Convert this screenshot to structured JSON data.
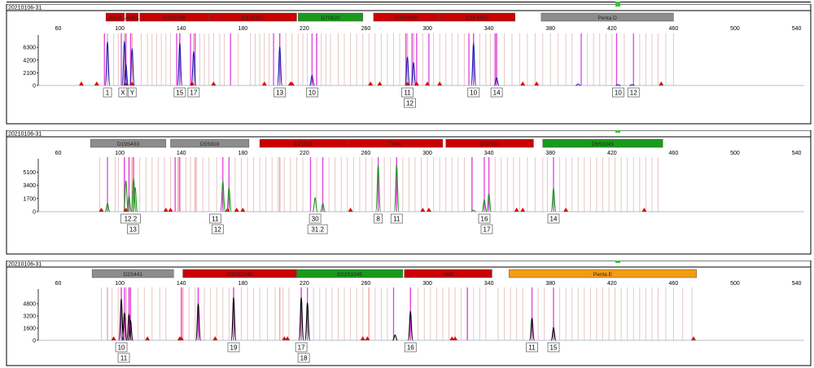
{
  "colors": {
    "red": "#cc0000",
    "green": "#1a9a1a",
    "grey": "#8c8c8c",
    "orange": "#f39c12",
    "blue": "#1c1cb4",
    "magenta": "#dd44dd",
    "indicator": "#2ecc2e"
  },
  "chart_data": [
    {
      "type": "line",
      "title": "20210106-31",
      "x_ticks": [
        60,
        100,
        140,
        180,
        220,
        260,
        300,
        340,
        380,
        420,
        460,
        500,
        540
      ],
      "y_ticks": [
        "6300",
        "4200",
        "2100",
        "0"
      ],
      "ylim": [
        0,
        7800
      ],
      "xlim": [
        47,
        545
      ],
      "series_color": "blue",
      "markers": [
        {
          "name": "Amel",
          "color": "red",
          "x1": 91,
          "x2": 103
        },
        {
          "name": "AMEL",
          "color": "red",
          "x1": 104,
          "x2": 112
        },
        {
          "name": "D3S1358",
          "color": "red",
          "x1": 113,
          "x2": 158
        },
        {
          "name": "D13S317",
          "color": "red",
          "x1": 158,
          "x2": 215
        },
        {
          "name": "D7S820",
          "color": "green",
          "x1": 216,
          "x2": 258
        },
        {
          "name": "D16S539",
          "color": "red",
          "x1": 265,
          "x2": 307
        },
        {
          "name": "CSF1PO",
          "color": "red",
          "x1": 307,
          "x2": 357
        },
        {
          "name": "Penta D",
          "color": "grey",
          "x1": 374,
          "x2": 460
        }
      ],
      "peaks": [
        {
          "x": 92,
          "y": 7200
        },
        {
          "x": 103,
          "y": 7300
        },
        {
          "x": 104,
          "y": 3500
        },
        {
          "x": 108,
          "y": 6100
        },
        {
          "x": 139,
          "y": 7000
        },
        {
          "x": 148,
          "y": 5600
        },
        {
          "x": 204,
          "y": 6400
        },
        {
          "x": 225,
          "y": 1700
        },
        {
          "x": 287,
          "y": 4700
        },
        {
          "x": 291,
          "y": 3800
        },
        {
          "x": 330,
          "y": 7000
        },
        {
          "x": 345,
          "y": 1300
        },
        {
          "x": 398,
          "y": 250
        },
        {
          "x": 424,
          "y": 150
        },
        {
          "x": 433,
          "y": 150
        }
      ],
      "alleles": [
        {
          "x": 92,
          "labels": [
            "1"
          ]
        },
        {
          "x": 102,
          "labels": [
            "X"
          ]
        },
        {
          "x": 108,
          "labels": [
            "Y"
          ]
        },
        {
          "x": 139,
          "labels": [
            "15"
          ]
        },
        {
          "x": 148,
          "labels": [
            "17"
          ]
        },
        {
          "x": 204,
          "labels": [
            "13"
          ]
        },
        {
          "x": 225,
          "labels": [
            "10"
          ]
        },
        {
          "x": 287,
          "labels": [
            "11",
            "12"
          ]
        },
        {
          "x": 330,
          "labels": [
            "10"
          ]
        },
        {
          "x": 345,
          "labels": [
            "14"
          ]
        },
        {
          "x": 424,
          "labels": [
            "10"
          ]
        },
        {
          "x": 434,
          "labels": [
            "12"
          ]
        }
      ],
      "bins": [
        90,
        101,
        104,
        107,
        137,
        139,
        146,
        149,
        172,
        200,
        204,
        225,
        228,
        286,
        290,
        293,
        301,
        327,
        330,
        344,
        345,
        400,
        423,
        434
      ],
      "bin_lines": [
        96,
        99,
        114,
        118,
        121,
        124,
        127,
        130,
        133,
        152,
        155,
        158,
        161,
        165,
        168,
        177,
        185,
        188,
        191,
        194,
        197,
        208,
        212,
        216,
        219,
        222,
        231,
        234,
        237,
        242,
        246,
        250,
        254,
        258,
        262,
        266,
        270,
        274,
        278,
        282,
        297,
        304,
        308,
        312,
        316,
        320,
        324,
        334,
        338,
        341,
        350,
        355,
        360,
        365,
        370,
        375,
        380,
        385,
        390,
        394,
        404,
        408,
        412,
        416,
        420,
        428,
        438,
        442,
        446,
        450,
        455,
        460
      ],
      "markers_pink": [
        92,
        103,
        108,
        139,
        148,
        204,
        228,
        287,
        291,
        330,
        345
      ],
      "spikes": [
        75,
        85,
        104,
        108,
        147,
        161,
        194,
        211,
        212,
        263,
        269,
        287,
        293,
        300,
        308,
        362,
        371,
        452
      ]
    },
    {
      "type": "line",
      "title": "20210106-31",
      "x_ticks": [
        60,
        100,
        140,
        180,
        220,
        260,
        300,
        340,
        380,
        420,
        460,
        500,
        540
      ],
      "y_ticks": [
        "5100",
        "3400",
        "1700",
        "0"
      ],
      "ylim": [
        0,
        6400
      ],
      "xlim": [
        47,
        545
      ],
      "series_color": "green",
      "markers": [
        {
          "name": "D19S433",
          "color": "grey",
          "x1": 81,
          "x2": 130
        },
        {
          "name": "D5S818",
          "color": "grey",
          "x1": 133,
          "x2": 184
        },
        {
          "name": "D21S11",
          "color": "red",
          "x1": 191,
          "x2": 248
        },
        {
          "name": "TH01",
          "color": "red",
          "x1": 248,
          "x2": 310
        },
        {
          "name": "D18S51",
          "color": "red",
          "x1": 312,
          "x2": 369
        },
        {
          "name": "D6S1043",
          "color": "green",
          "x1": 375,
          "x2": 453
        }
      ],
      "peaks": [
        {
          "x": 92,
          "y": 1100
        },
        {
          "x": 104,
          "y": 4000
        },
        {
          "x": 106,
          "y": 2000
        },
        {
          "x": 109,
          "y": 4300
        },
        {
          "x": 110,
          "y": 3100
        },
        {
          "x": 167,
          "y": 3900
        },
        {
          "x": 171,
          "y": 3100
        },
        {
          "x": 227,
          "y": 1800
        },
        {
          "x": 232,
          "y": 1100
        },
        {
          "x": 268,
          "y": 6000
        },
        {
          "x": 280,
          "y": 6000
        },
        {
          "x": 330,
          "y": 200
        },
        {
          "x": 337,
          "y": 1600
        },
        {
          "x": 340,
          "y": 2300
        },
        {
          "x": 382,
          "y": 3000
        }
      ],
      "alleles": [
        {
          "x": 107,
          "labels": [
            "12.2",
            "13"
          ]
        },
        {
          "x": 162,
          "labels": [
            "11",
            "12"
          ]
        },
        {
          "x": 227,
          "labels": [
            "30",
            "31.2"
          ]
        },
        {
          "x": 268,
          "labels": [
            "8"
          ]
        },
        {
          "x": 280,
          "labels": [
            "11"
          ]
        },
        {
          "x": 337,
          "labels": [
            "16",
            "17"
          ]
        },
        {
          "x": 382,
          "labels": [
            "14"
          ]
        }
      ],
      "bins": [
        92,
        103,
        106,
        109,
        136,
        139,
        167,
        171,
        224,
        232,
        268,
        280,
        329,
        337,
        340,
        382
      ],
      "bin_lines": [
        87,
        97,
        99,
        113,
        117,
        121,
        125,
        129,
        133,
        143,
        146,
        150,
        154,
        158,
        163,
        175,
        179,
        183,
        187,
        191,
        195,
        199,
        203,
        207,
        211,
        215,
        219,
        228,
        236,
        240,
        244,
        248,
        252,
        256,
        260,
        264,
        272,
        276,
        284,
        288,
        292,
        296,
        300,
        304,
        308,
        312,
        316,
        320,
        324,
        344,
        348,
        352,
        356,
        360,
        365,
        370,
        375,
        378,
        386,
        390,
        394,
        398,
        402,
        406,
        410,
        414,
        418,
        422,
        426,
        430,
        434,
        438,
        442,
        446,
        450
      ],
      "markers_pink": [
        103,
        106,
        108,
        138,
        149,
        204,
        280,
        329
      ],
      "spikes": [
        88,
        104,
        130,
        133,
        170,
        176,
        180,
        250,
        297,
        301,
        358,
        362,
        390,
        441
      ]
    },
    {
      "type": "line",
      "title": "20210106-31",
      "x_ticks": [
        60,
        100,
        140,
        180,
        220,
        260,
        300,
        340,
        380,
        420,
        460,
        500,
        540
      ],
      "y_ticks": [
        "4800",
        "3200",
        "1600",
        "0"
      ],
      "ylim": [
        0,
        6300
      ],
      "xlim": [
        47,
        545
      ],
      "series_color": "black",
      "markers": [
        {
          "name": "D2S441",
          "color": "grey",
          "x1": 82,
          "x2": 135
        },
        {
          "name": "D10S1248",
          "color": "red",
          "x1": 141,
          "x2": 215
        },
        {
          "name": "D22S1045",
          "color": "green",
          "x1": 215,
          "x2": 284
        },
        {
          "name": "vWA",
          "color": "red",
          "x1": 285,
          "x2": 342
        },
        {
          "name": "Penta E",
          "color": "orange",
          "x1": 353,
          "x2": 475
        }
      ],
      "peaks": [
        {
          "x": 101,
          "y": 5400
        },
        {
          "x": 103,
          "y": 3600
        },
        {
          "x": 106,
          "y": 3400
        },
        {
          "x": 107,
          "y": 2600
        },
        {
          "x": 151,
          "y": 4800
        },
        {
          "x": 174,
          "y": 5600
        },
        {
          "x": 218,
          "y": 5600
        },
        {
          "x": 222,
          "y": 4900
        },
        {
          "x": 279,
          "y": 700
        },
        {
          "x": 289,
          "y": 3800
        },
        {
          "x": 368,
          "y": 2900
        },
        {
          "x": 382,
          "y": 1700
        }
      ],
      "alleles": [
        {
          "x": 101,
          "labels": [
            "10",
            "11"
          ]
        },
        {
          "x": 174,
          "labels": [
            "19"
          ]
        },
        {
          "x": 218,
          "labels": [
            "17",
            "18"
          ]
        },
        {
          "x": 289,
          "labels": [
            "16"
          ]
        },
        {
          "x": 368,
          "labels": [
            "11"
          ]
        },
        {
          "x": 382,
          "labels": [
            "15"
          ]
        }
      ],
      "bins": [
        101,
        103,
        106,
        107,
        140,
        151,
        174,
        218,
        222,
        278,
        289,
        326,
        368,
        382
      ],
      "bin_lines": [
        88,
        95,
        99,
        112,
        116,
        121,
        126,
        130,
        145,
        149,
        155,
        159,
        163,
        167,
        171,
        179,
        183,
        187,
        191,
        196,
        201,
        206,
        210,
        226,
        230,
        234,
        238,
        242,
        246,
        250,
        254,
        258,
        262,
        266,
        270,
        274,
        294,
        298,
        302,
        306,
        310,
        314,
        318,
        322,
        330,
        334,
        338,
        346,
        350,
        354,
        358,
        362,
        372,
        376,
        386,
        390,
        394,
        398,
        402,
        406,
        410,
        414,
        418,
        422,
        426,
        430,
        434,
        438,
        442,
        446,
        450,
        455,
        460,
        466,
        472
      ],
      "markers_pink": [
        92,
        101,
        104,
        106,
        141,
        151,
        174,
        204,
        218,
        262,
        289,
        326
      ],
      "spikes": [
        96,
        118,
        139,
        140,
        162,
        207,
        209,
        258,
        261,
        316,
        318,
        473
      ]
    }
  ]
}
